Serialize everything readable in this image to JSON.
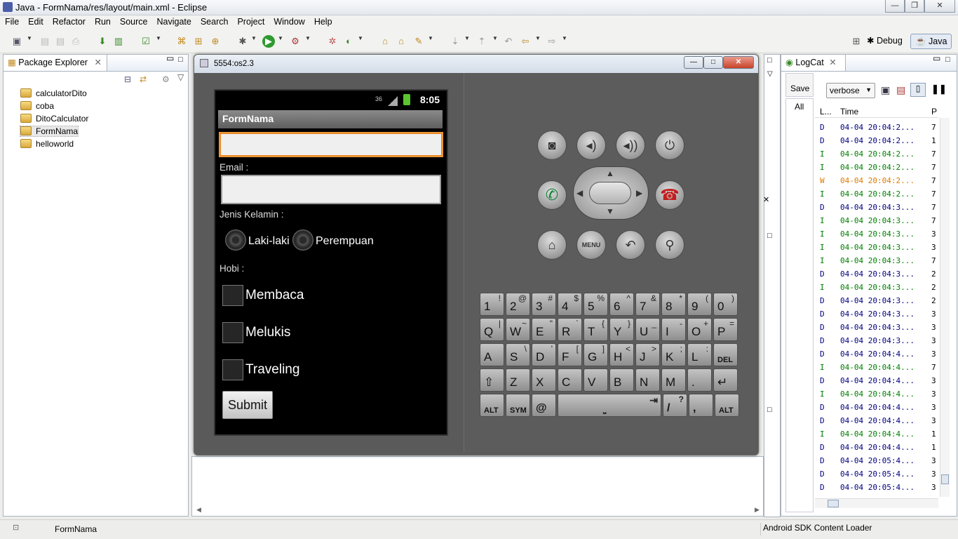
{
  "window": {
    "title": "Java - FormNama/res/layout/main.xml - Eclipse"
  },
  "menu": [
    "File",
    "Edit",
    "Refactor",
    "Run",
    "Source",
    "Navigate",
    "Search",
    "Project",
    "Window",
    "Help"
  ],
  "perspectives": {
    "debug": "Debug",
    "java": "Java"
  },
  "package_explorer": {
    "title": "Package Explorer",
    "projects": [
      "calculatorDito",
      "coba",
      "DitoCalculator",
      "FormNama",
      "helloworld"
    ],
    "selected": "FormNama"
  },
  "emulator": {
    "title": "5554:os2.3",
    "status_time": "8:05",
    "app_title": "FormNama",
    "email_label": "Email :",
    "gender_label": "Jenis Kelamin :",
    "gender_options": [
      "Laki-laki",
      "Perempuan"
    ],
    "hobby_label": "Hobi :",
    "hobbies": [
      "Membaca",
      "Melukis",
      "Traveling"
    ],
    "submit_label": "Submit",
    "menu_key": "MENU"
  },
  "keyboard": {
    "rows": [
      [
        [
          "1",
          "!"
        ],
        [
          "2",
          "@"
        ],
        [
          "3",
          "#"
        ],
        [
          "4",
          "$"
        ],
        [
          "5",
          "%"
        ],
        [
          "6",
          "^"
        ],
        [
          "7",
          "&"
        ],
        [
          "8",
          "*"
        ],
        [
          "9",
          "("
        ],
        [
          "0",
          ")"
        ]
      ],
      [
        [
          "Q",
          "|"
        ],
        [
          "W",
          "~"
        ],
        [
          "E",
          "\""
        ],
        [
          "R",
          "`"
        ],
        [
          "T",
          "{"
        ],
        [
          "Y",
          "}"
        ],
        [
          "U",
          "_"
        ],
        [
          "I",
          "-"
        ],
        [
          "O",
          "+"
        ],
        [
          "P",
          "="
        ]
      ],
      [
        [
          "A",
          ""
        ],
        [
          "S",
          "\\"
        ],
        [
          "D",
          "'"
        ],
        [
          "F",
          "["
        ],
        [
          "G",
          "]"
        ],
        [
          "H",
          "<"
        ],
        [
          "J",
          ">"
        ],
        [
          "K",
          ";"
        ],
        [
          "L",
          ":"
        ],
        [
          "DEL",
          ""
        ]
      ],
      [
        [
          "⇧",
          ""
        ],
        [
          "Z",
          ""
        ],
        [
          "X",
          ""
        ],
        [
          "C",
          ""
        ],
        [
          "V",
          ""
        ],
        [
          "B",
          ""
        ],
        [
          "N",
          ""
        ],
        [
          "M",
          ""
        ],
        [
          ".",
          ""
        ],
        [
          "↵",
          ""
        ]
      ]
    ],
    "bottom": {
      "alt": "ALT",
      "sym": "SYM",
      "at": "@",
      "slash": "/",
      "question": "?",
      "comma": ","
    }
  },
  "logcat": {
    "title": "LogCat",
    "save_label": "Save",
    "all_label": "All",
    "level_select": "verbose",
    "col_level": "L...",
    "col_time": "Time",
    "col_p": "P",
    "rows": [
      {
        "level": "D",
        "time": "04-04 20:04:2...",
        "p": "7",
        "color": "#000080"
      },
      {
        "level": "D",
        "time": "04-04 20:04:2...",
        "p": "1",
        "color": "#000080"
      },
      {
        "level": "I",
        "time": "04-04 20:04:2...",
        "p": "7",
        "color": "#008000"
      },
      {
        "level": "I",
        "time": "04-04 20:04:2...",
        "p": "7",
        "color": "#008000"
      },
      {
        "level": "W",
        "time": "04-04 20:04:2...",
        "p": "7",
        "color": "#e07a00"
      },
      {
        "level": "I",
        "time": "04-04 20:04:2...",
        "p": "7",
        "color": "#008000"
      },
      {
        "level": "D",
        "time": "04-04 20:04:3...",
        "p": "7",
        "color": "#000080"
      },
      {
        "level": "I",
        "time": "04-04 20:04:3...",
        "p": "7",
        "color": "#008000"
      },
      {
        "level": "I",
        "time": "04-04 20:04:3...",
        "p": "3",
        "color": "#008000"
      },
      {
        "level": "I",
        "time": "04-04 20:04:3...",
        "p": "3",
        "color": "#008000"
      },
      {
        "level": "I",
        "time": "04-04 20:04:3...",
        "p": "7",
        "color": "#008000"
      },
      {
        "level": "D",
        "time": "04-04 20:04:3...",
        "p": "2",
        "color": "#000080"
      },
      {
        "level": "I",
        "time": "04-04 20:04:3...",
        "p": "2",
        "color": "#008000"
      },
      {
        "level": "D",
        "time": "04-04 20:04:3...",
        "p": "2",
        "color": "#000080"
      },
      {
        "level": "D",
        "time": "04-04 20:04:3...",
        "p": "3",
        "color": "#000080"
      },
      {
        "level": "D",
        "time": "04-04 20:04:3...",
        "p": "3",
        "color": "#000080"
      },
      {
        "level": "D",
        "time": "04-04 20:04:3...",
        "p": "3",
        "color": "#000080"
      },
      {
        "level": "D",
        "time": "04-04 20:04:4...",
        "p": "3",
        "color": "#000080"
      },
      {
        "level": "I",
        "time": "04-04 20:04:4...",
        "p": "7",
        "color": "#008000"
      },
      {
        "level": "D",
        "time": "04-04 20:04:4...",
        "p": "3",
        "color": "#000080"
      },
      {
        "level": "I",
        "time": "04-04 20:04:4...",
        "p": "3",
        "color": "#008000"
      },
      {
        "level": "D",
        "time": "04-04 20:04:4...",
        "p": "3",
        "color": "#000080"
      },
      {
        "level": "D",
        "time": "04-04 20:04:4...",
        "p": "3",
        "color": "#000080"
      },
      {
        "level": "I",
        "time": "04-04 20:04:4...",
        "p": "1",
        "color": "#008000"
      },
      {
        "level": "D",
        "time": "04-04 20:04:4...",
        "p": "1",
        "color": "#000080"
      },
      {
        "level": "D",
        "time": "04-04 20:05:4...",
        "p": "3",
        "color": "#000080"
      },
      {
        "level": "D",
        "time": "04-04 20:05:4...",
        "p": "3",
        "color": "#000080"
      },
      {
        "level": "D",
        "time": "04-04 20:05:4...",
        "p": "3",
        "color": "#000080"
      }
    ]
  },
  "statusbar": {
    "left": "FormNama",
    "right": "Android SDK Content Loader"
  }
}
